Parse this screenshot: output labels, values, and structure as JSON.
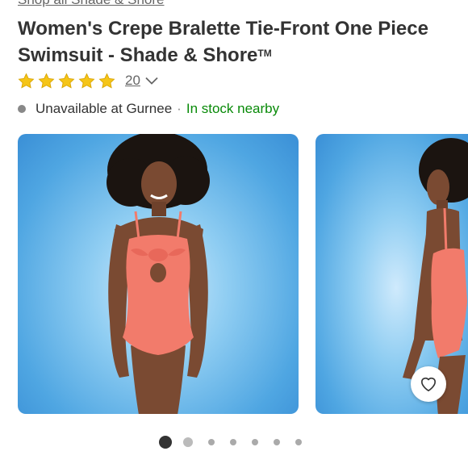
{
  "breadcrumb": {
    "shop_all": "Shop all Shade & Shore"
  },
  "product": {
    "title": "Women's Crepe Bralette Tie-Front One Piece Swimsuit - Shade & Shore",
    "trademark": "TM"
  },
  "rating": {
    "stars": 5,
    "max_stars": 5,
    "review_count": "20"
  },
  "availability": {
    "status": "Unavailable at Gurnee",
    "separator": "·",
    "nearby": "In stock nearby"
  },
  "carousel": {
    "total_images": 7,
    "active_index": 0
  },
  "icons": {
    "star": "star-icon",
    "chevron": "chevron-down-icon",
    "heart": "heart-icon"
  },
  "colors": {
    "star": "#F5C518",
    "in_stock": "#088A08",
    "swimsuit": "#F27B6B",
    "background_blue": "#4FA6E2"
  }
}
